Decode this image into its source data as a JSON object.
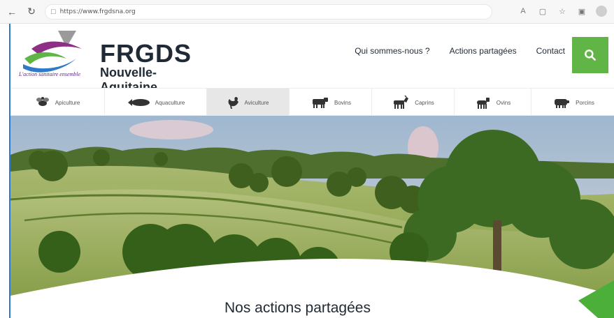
{
  "browser": {
    "back_icon": "back-arrow-icon",
    "reload_icon": "reload-icon",
    "lock_icon": "lock-icon",
    "url": "https://www.frgdsna.org"
  },
  "site": {
    "logo": {
      "title": "FRGDS",
      "subtitle": "Nouvelle-Aquitaine",
      "tagline": "L'action sanitaire ensemble"
    },
    "nav": [
      "Qui sommes-nous ?",
      "Actions partagées",
      "Contact"
    ],
    "search_icon": "search-icon",
    "categories": [
      {
        "label": "Apiculture",
        "icon": "bee-icon"
      },
      {
        "label": "Aquaculture",
        "icon": "fish-icon"
      },
      {
        "label": "Aviculture",
        "icon": "chicken-icon",
        "active": true
      },
      {
        "label": "Bovins",
        "icon": "cow-icon"
      },
      {
        "label": "Caprins",
        "icon": "goat-icon"
      },
      {
        "label": "Ovins",
        "icon": "sheep-icon"
      },
      {
        "label": "Porcins",
        "icon": "pig-icon"
      }
    ],
    "section_heading": "Nos actions partagées"
  },
  "colors": {
    "accent_green": "#61b546",
    "logo_purple": "#8e2f86",
    "logo_blue": "#2f79c9",
    "text_dark": "#1f2a36"
  }
}
